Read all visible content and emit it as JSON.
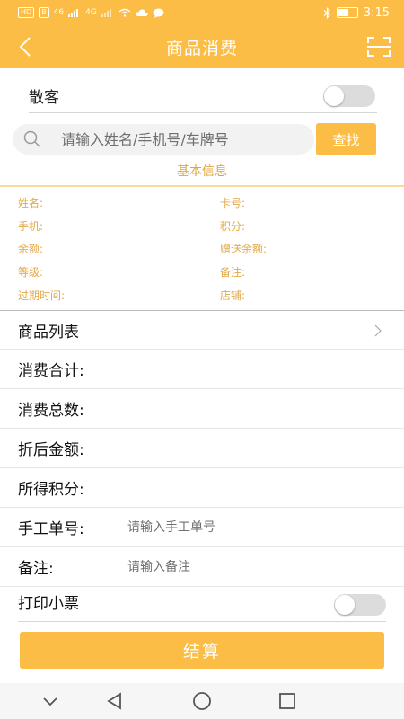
{
  "status_bar": {
    "left_badges": [
      "HD",
      "B",
      "46",
      "4G"
    ],
    "time": "3:15",
    "battery_level": "54",
    "battery_fraction": 0.54
  },
  "header": {
    "title": "商品消费",
    "back_icon": "chevron-left-icon",
    "scan_icon": "scan-icon"
  },
  "guest": {
    "label": "散客",
    "toggle_on": false
  },
  "search": {
    "placeholder": "请输入姓名/手机号/车牌号",
    "button_label": "查找"
  },
  "basic_info": {
    "title": "基本信息",
    "left": [
      "姓名:",
      "手机:",
      "余额:",
      "等级:",
      "过期时间:"
    ],
    "right": [
      "卡号:",
      "积分:",
      "赠送余额:",
      "备注:",
      "店铺:"
    ]
  },
  "form": {
    "product_list_label": "商品列表",
    "total_amount_label": "消费合计:",
    "total_count_label": "消费总数:",
    "discount_amount_label": "折后金额:",
    "points_earned_label": "所得积分:",
    "manual_no_label": "手工单号:",
    "manual_no_placeholder": "请输入手工单号",
    "remark_label": "备注:",
    "remark_placeholder": "请输入备注"
  },
  "print": {
    "label": "打印小票",
    "toggle_on": false
  },
  "submit_label": "结算",
  "colors": {
    "accent": "#fbbd45",
    "accent_text": "#e2a849",
    "toggle_off": "#dcdcdc"
  }
}
